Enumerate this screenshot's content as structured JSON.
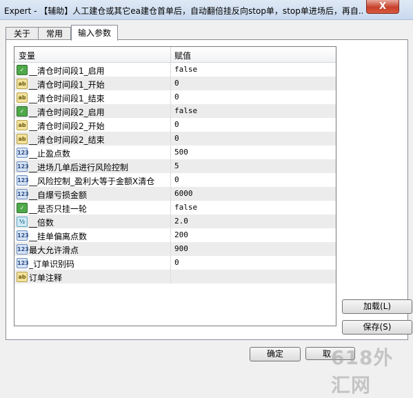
{
  "window": {
    "title": "Expert - 【辅助】人工建仓或其它ea建仓首单后，自动翻倍挂反向stop单，stop单进场后，再自...",
    "close_label": "X"
  },
  "tabs": [
    {
      "label": "关于"
    },
    {
      "label": "常用"
    },
    {
      "label": "输入参数"
    }
  ],
  "grid": {
    "col_variable": "变量",
    "col_value": "赋值",
    "rows": [
      {
        "icon": "bool-icon",
        "name": "__清仓时间段1_启用",
        "value": "false"
      },
      {
        "icon": "string-icon",
        "name": "__清仓时间段1_开始",
        "value": "0"
      },
      {
        "icon": "string-icon",
        "name": "__清仓时间段1_结束",
        "value": "0"
      },
      {
        "icon": "bool-icon",
        "name": "__清仓时间段2_启用",
        "value": "false"
      },
      {
        "icon": "string-icon",
        "name": "__清仓时间段2_开始",
        "value": "0"
      },
      {
        "icon": "string-icon",
        "name": "__清仓时间段2_结束",
        "value": "0"
      },
      {
        "icon": "int-icon",
        "name": "__止盈点数",
        "value": "500"
      },
      {
        "icon": "int-icon",
        "name": "__进场几单后进行风险控制",
        "value": "5"
      },
      {
        "icon": "int-icon",
        "name": "__风险控制_盈利大等于金额X清仓",
        "value": "0"
      },
      {
        "icon": "int-icon",
        "name": "__自爆亏损金额",
        "value": "6000"
      },
      {
        "icon": "bool-icon",
        "name": "__是否只挂一轮",
        "value": "false"
      },
      {
        "icon": "double-icon",
        "name": "__倍数",
        "value": "2.0"
      },
      {
        "icon": "int-icon",
        "name": "__挂单偏离点数",
        "value": "200"
      },
      {
        "icon": "int-icon",
        "name": "最大允许滑点",
        "value": "900"
      },
      {
        "icon": "int-icon",
        "name": "_订单识别码",
        "value": "0"
      },
      {
        "icon": "string-icon",
        "name": "订单注释",
        "value": ""
      }
    ]
  },
  "buttons": {
    "load": "加载(L)",
    "save": "保存(S)",
    "ok": "确定",
    "cancel_partial": "取"
  },
  "watermark": "618外汇网"
}
